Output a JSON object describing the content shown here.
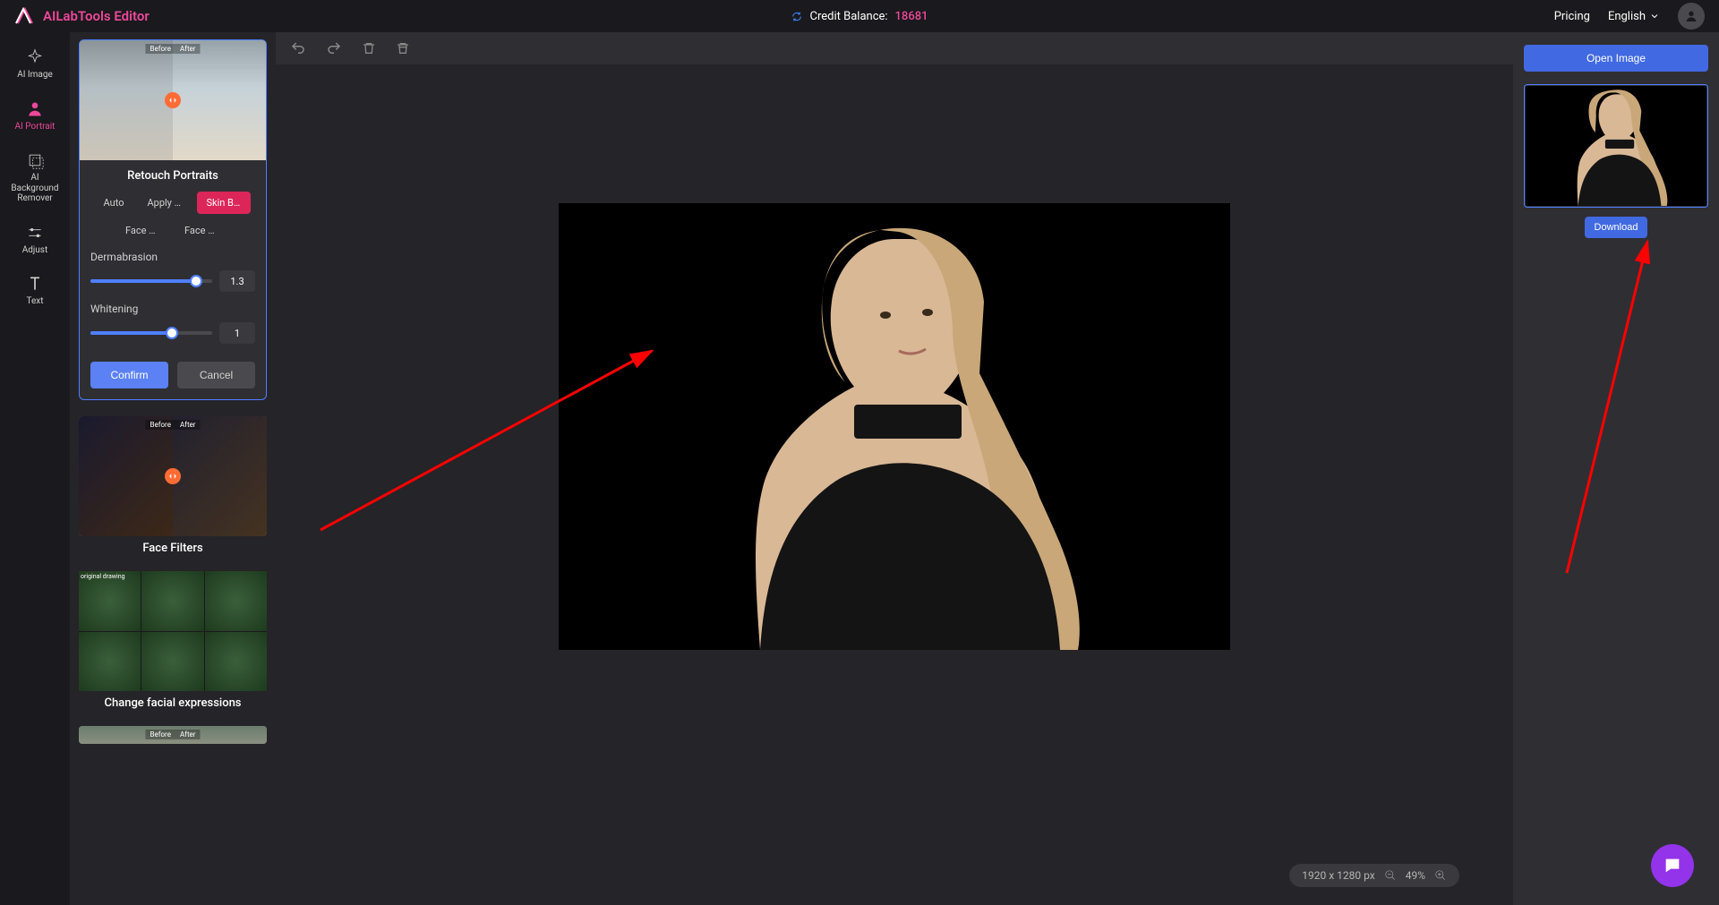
{
  "header": {
    "app_name": "AILabTools Editor",
    "credit_label": "Credit Balance:",
    "credit_value": "18681",
    "pricing": "Pricing",
    "language": "English"
  },
  "nav": {
    "items": [
      {
        "label": "AI Image",
        "icon": "sparkle"
      },
      {
        "label": "AI Portrait",
        "icon": "person",
        "active": true
      },
      {
        "label": "AI Background Remover",
        "icon": "crop"
      },
      {
        "label": "Adjust",
        "icon": "sliders"
      },
      {
        "label": "Text",
        "icon": "text"
      }
    ]
  },
  "tools": {
    "retouch": {
      "title": "Retouch Portraits",
      "ba_before": "Before",
      "ba_after": "After",
      "tabs": [
        {
          "label": "Auto"
        },
        {
          "label": "Apply M..."
        },
        {
          "label": "Skin Be...",
          "active": true
        },
        {
          "label": "Face Be..."
        },
        {
          "label": "Face Sli..."
        }
      ],
      "sliders": [
        {
          "label": "Dermabrasion",
          "value": "1.3",
          "pct": 87
        },
        {
          "label": "Whitening",
          "value": "1",
          "pct": 67
        }
      ],
      "confirm": "Confirm",
      "cancel": "Cancel"
    },
    "filters": {
      "title": "Face Filters",
      "ba_before": "Before",
      "ba_after": "After"
    },
    "expressions": {
      "title": "Change facial expressions",
      "original": "original drawing"
    },
    "next": {
      "ba_before": "Before",
      "ba_after": "After"
    }
  },
  "right": {
    "open": "Open Image",
    "download": "Download"
  },
  "canvas": {
    "dimensions": "1920 x 1280 px",
    "zoom": "49%"
  },
  "colors": {
    "accent_pink": "#ec4899",
    "accent_blue": "#4f7fff",
    "accent_red_btn": "#dc2659"
  }
}
